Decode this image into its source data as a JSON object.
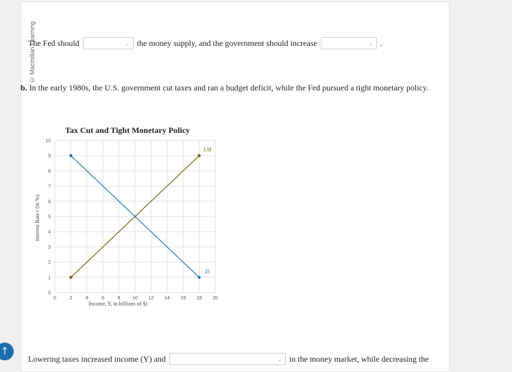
{
  "side_label": "© Macmillan Learning",
  "q1": {
    "before": "The Fed should",
    "middle": "the money supply, and the government should increase",
    "end": "."
  },
  "part_b": {
    "label": "b.",
    "text": "In the early 1980s, the U.S. government cut taxes and ran a budget deficit, while the Fed pursued a tight monetary policy."
  },
  "q2": {
    "before": "Lowering taxes increased income (Y) and",
    "after": "in the money market, while decreasing the"
  },
  "fab_icon": "arrow-up-icon",
  "chart_data": {
    "type": "line",
    "title": "Tax Cut and Tight Monetary Policy",
    "xlabel": "Income, Y, in billions of $)",
    "ylabel": "Interest Rate r (in %)",
    "xlim": [
      0,
      20
    ],
    "ylim": [
      0,
      10
    ],
    "xticks": [
      0,
      2,
      4,
      6,
      8,
      10,
      12,
      14,
      16,
      18,
      20
    ],
    "yticks": [
      0,
      1,
      2,
      3,
      4,
      5,
      6,
      7,
      8,
      9,
      10
    ],
    "grid": true,
    "series": [
      {
        "name": "LM",
        "color": "#7a5c10",
        "points": [
          [
            2,
            1
          ],
          [
            18,
            9
          ]
        ]
      },
      {
        "name": "IS",
        "color": "#1f77b4",
        "points": [
          [
            2,
            9
          ],
          [
            18,
            1
          ]
        ]
      }
    ]
  }
}
